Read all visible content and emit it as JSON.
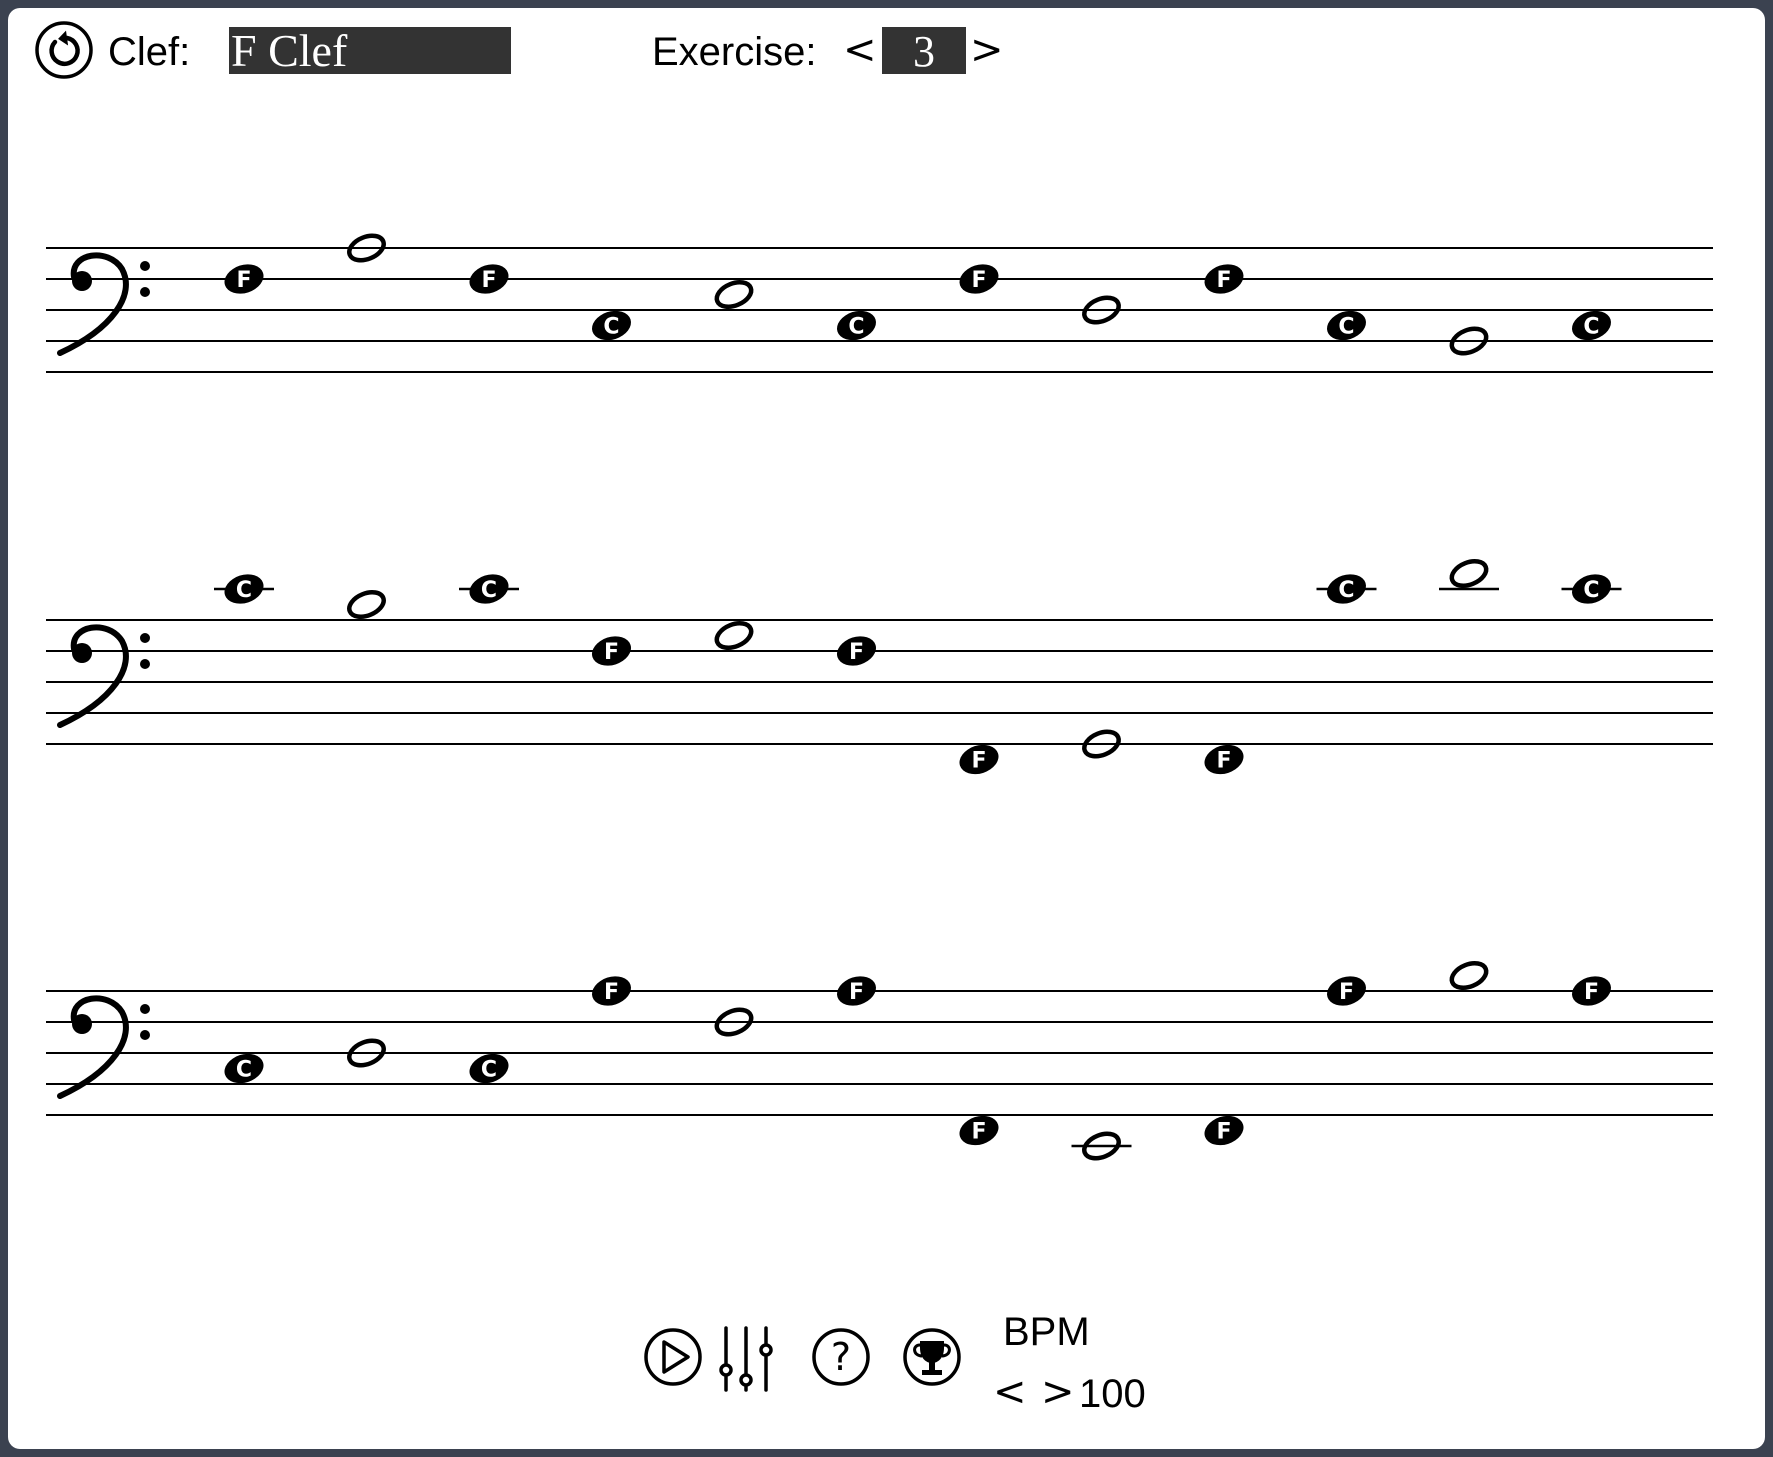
{
  "header": {
    "clef_label": "Clef:",
    "clef_value": "F Clef",
    "exercise_label": "Exercise:",
    "exercise_prev": "<",
    "exercise_value": "3",
    "exercise_next": ">"
  },
  "icons": {
    "reset": "reset-icon",
    "play": "play-icon",
    "mixer": "mixer-icon",
    "help": "help-icon",
    "trophy": "trophy-icon"
  },
  "footer": {
    "bpm_label": "BPM",
    "bpm_prev": "<",
    "bpm_next": ">",
    "bpm_value": "100"
  },
  "score": {
    "clef": "bass",
    "systems": [
      {
        "notes": [
          {
            "pitch": "F3",
            "type": "quarter",
            "label": "F"
          },
          {
            "pitch": "A3",
            "type": "half"
          },
          {
            "pitch": "F3",
            "type": "quarter",
            "label": "F"
          },
          {
            "pitch": "C3",
            "type": "quarter",
            "label": "C"
          },
          {
            "pitch": "E3",
            "type": "half"
          },
          {
            "pitch": "C3",
            "type": "quarter",
            "label": "C"
          },
          {
            "pitch": "F3",
            "type": "quarter",
            "label": "F"
          },
          {
            "pitch": "D3",
            "type": "half"
          },
          {
            "pitch": "F3",
            "type": "quarter",
            "label": "F"
          },
          {
            "pitch": "C3",
            "type": "quarter",
            "label": "C"
          },
          {
            "pitch": "B2",
            "type": "half"
          },
          {
            "pitch": "C3",
            "type": "quarter",
            "label": "C"
          }
        ]
      },
      {
        "notes": [
          {
            "pitch": "C4",
            "type": "quarter",
            "label": "C"
          },
          {
            "pitch": "B3",
            "type": "half"
          },
          {
            "pitch": "C4",
            "type": "quarter",
            "label": "C"
          },
          {
            "pitch": "F3",
            "type": "quarter",
            "label": "F"
          },
          {
            "pitch": "G3",
            "type": "half"
          },
          {
            "pitch": "F3",
            "type": "quarter",
            "label": "F"
          },
          {
            "pitch": "F2",
            "type": "quarter",
            "label": "F"
          },
          {
            "pitch": "G2",
            "type": "half"
          },
          {
            "pitch": "F2",
            "type": "quarter",
            "label": "F"
          },
          {
            "pitch": "C4",
            "type": "quarter",
            "label": "C"
          },
          {
            "pitch": "D4",
            "type": "half"
          },
          {
            "pitch": "C4",
            "type": "quarter",
            "label": "C"
          }
        ]
      },
      {
        "notes": [
          {
            "pitch": "C3",
            "type": "quarter",
            "label": "C"
          },
          {
            "pitch": "D3",
            "type": "half"
          },
          {
            "pitch": "C3",
            "type": "quarter",
            "label": "C"
          },
          {
            "pitch": "A3",
            "type": "quarter",
            "label": "F"
          },
          {
            "pitch": "F3",
            "type": "half"
          },
          {
            "pitch": "A3",
            "type": "quarter",
            "label": "F"
          },
          {
            "pitch": "F2",
            "type": "quarter",
            "label": "F"
          },
          {
            "pitch": "E2",
            "type": "half"
          },
          {
            "pitch": "F2",
            "type": "quarter",
            "label": "F"
          },
          {
            "pitch": "A3",
            "type": "quarter",
            "label": "F"
          },
          {
            "pitch": "B3",
            "type": "half"
          },
          {
            "pitch": "A3",
            "type": "quarter",
            "label": "F"
          }
        ]
      }
    ]
  }
}
